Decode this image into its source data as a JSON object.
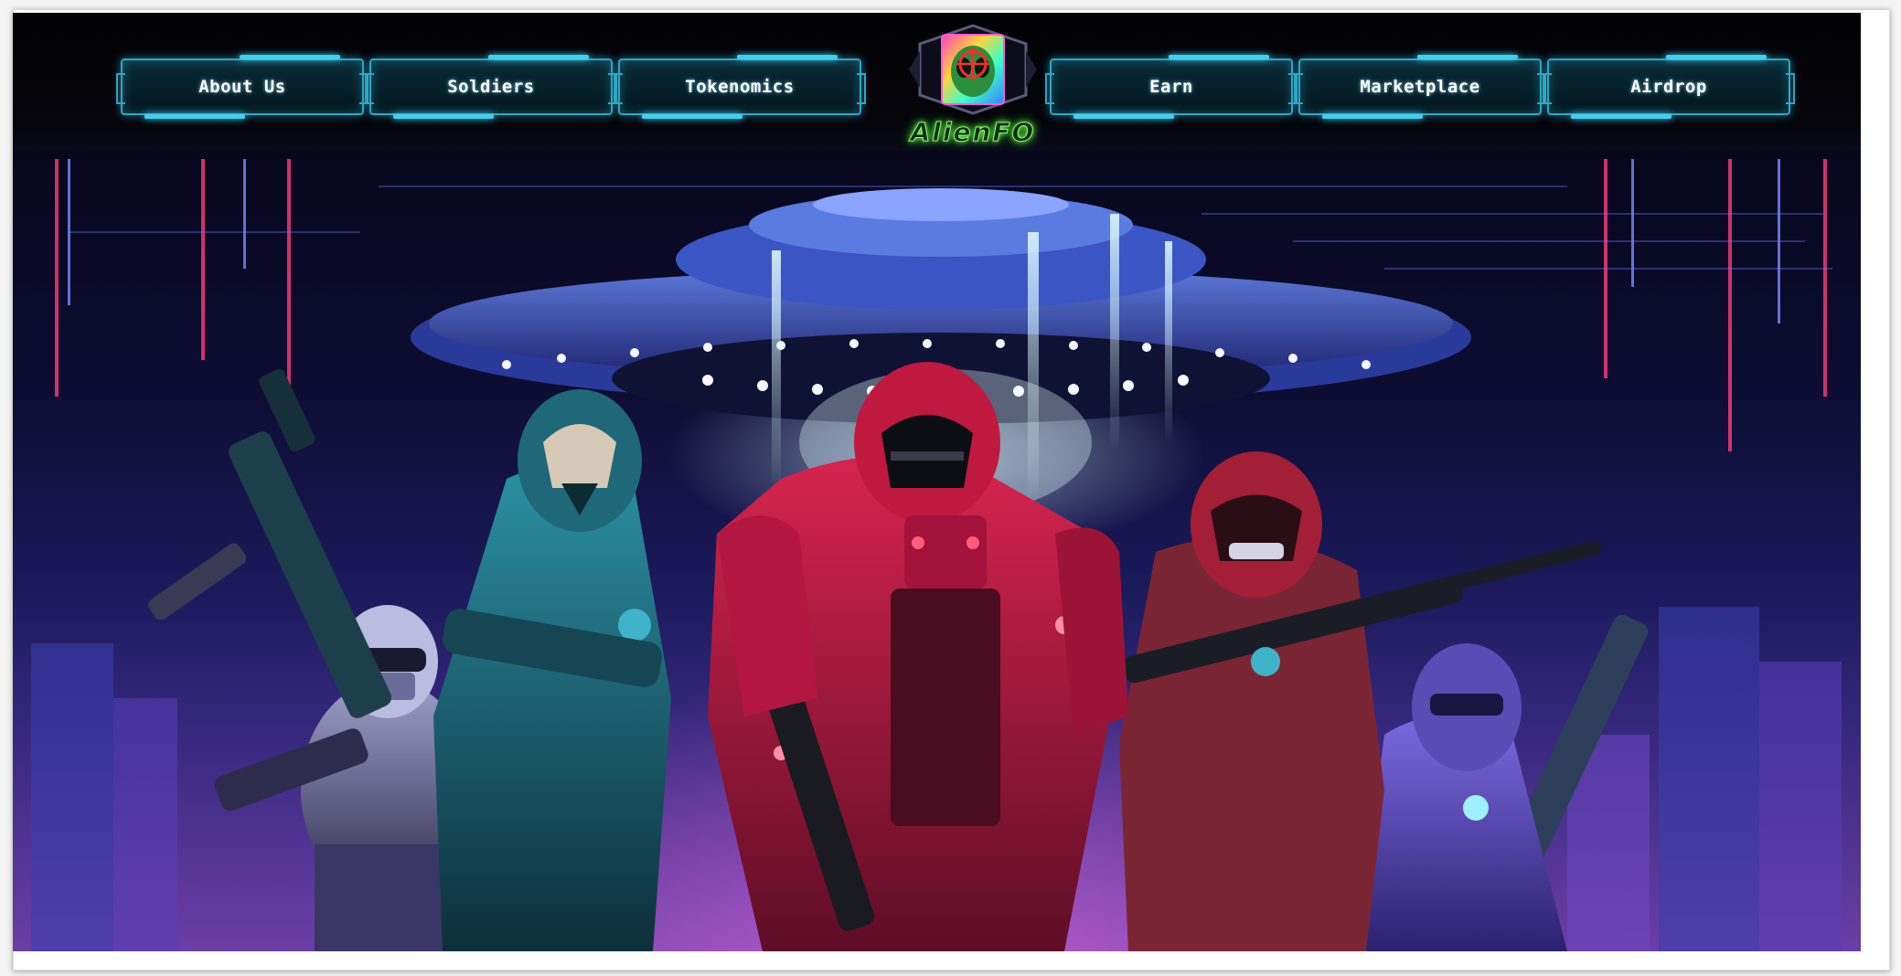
{
  "nav": {
    "left": [
      {
        "label": "About Us"
      },
      {
        "label": "Soldiers"
      },
      {
        "label": "Tokenomics"
      }
    ],
    "right": [
      {
        "label": "Earn"
      },
      {
        "label": "Marketplace"
      },
      {
        "label": "Airdrop"
      }
    ]
  },
  "logo": {
    "text": "AlienFO",
    "icon": "alien-target-icon"
  },
  "hero": {
    "illustration": "soldiers-ufo-illustration"
  },
  "colors": {
    "accent": "#2fa6c0",
    "glow": "#3fd0ef",
    "logo_green": "#7dff59",
    "background": "#05040c",
    "armor_red": "#b3163f",
    "armor_teal": "#1f6878",
    "armor_purple": "#5b4bb5"
  }
}
